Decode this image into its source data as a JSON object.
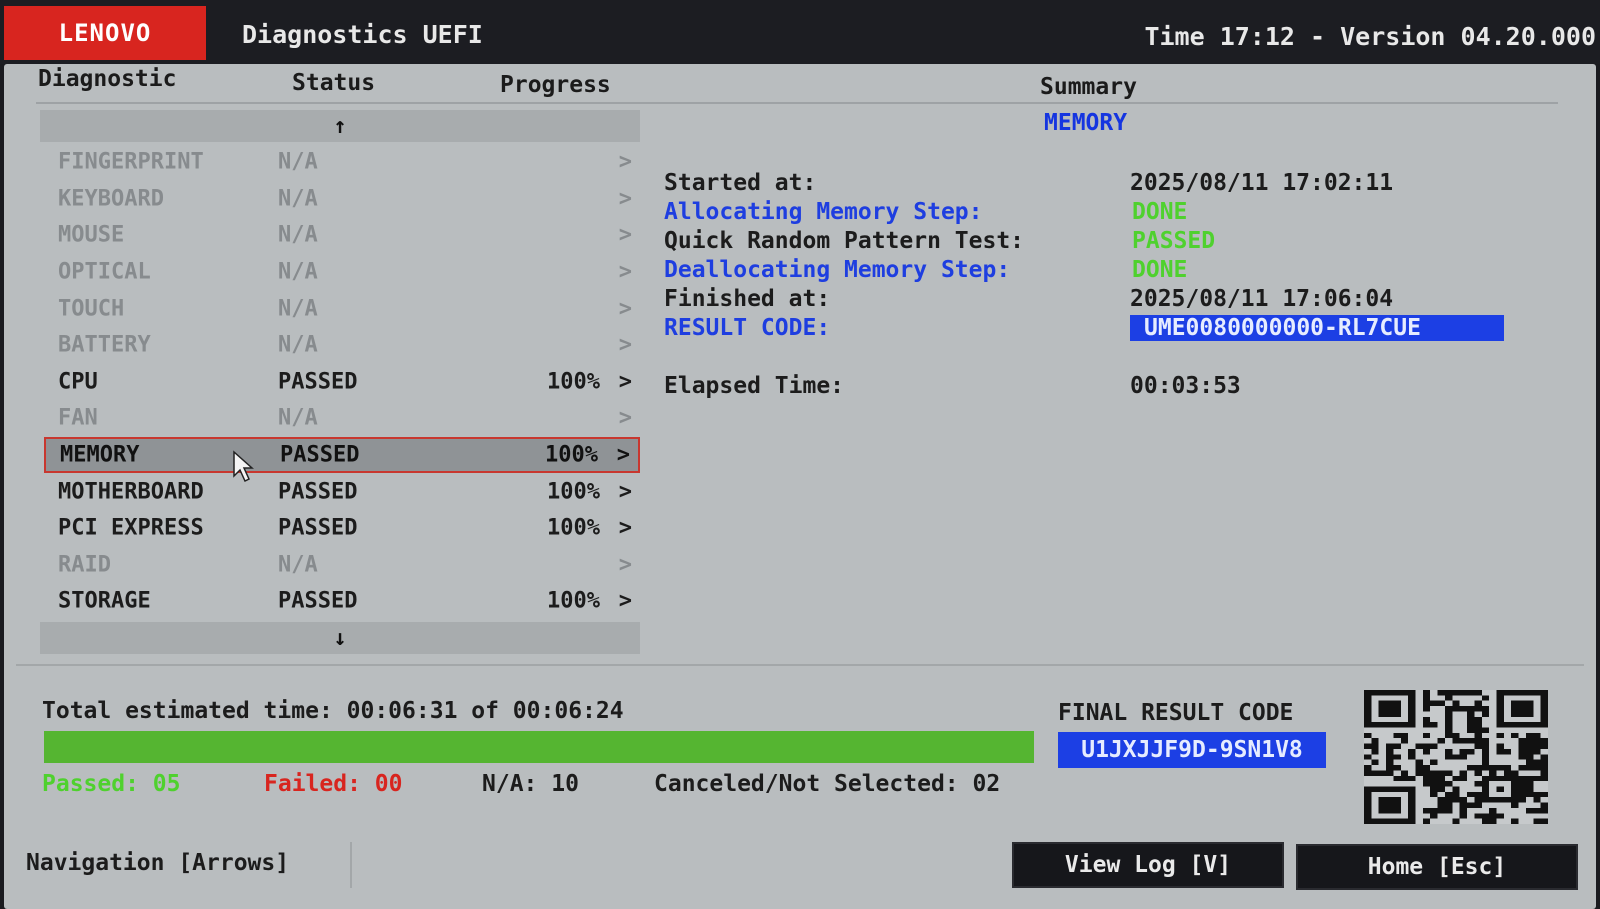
{
  "header": {
    "brand": "LENOVO",
    "app_title": "Diagnostics UEFI",
    "time_version": "Time 17:12 - Version 04.20.000"
  },
  "columns": {
    "diagnostic": "Diagnostic",
    "status": "Status",
    "progress": "Progress",
    "summary": "Summary"
  },
  "scroll": {
    "up": "↑",
    "down": "↓"
  },
  "diagnostics": [
    {
      "name": "FINGERPRINT",
      "status": "N/A",
      "progress": "",
      "chevron": ">"
    },
    {
      "name": "KEYBOARD",
      "status": "N/A",
      "progress": "",
      "chevron": ">"
    },
    {
      "name": "MOUSE",
      "status": "N/A",
      "progress": "",
      "chevron": ">"
    },
    {
      "name": "OPTICAL",
      "status": "N/A",
      "progress": "",
      "chevron": ">"
    },
    {
      "name": "TOUCH",
      "status": "N/A",
      "progress": "",
      "chevron": ">"
    },
    {
      "name": "BATTERY",
      "status": "N/A",
      "progress": "",
      "chevron": ">"
    },
    {
      "name": "CPU",
      "status": "PASSED",
      "progress": "100%",
      "chevron": ">"
    },
    {
      "name": "FAN",
      "status": "N/A",
      "progress": "",
      "chevron": ">"
    },
    {
      "name": "MEMORY",
      "status": "PASSED",
      "progress": "100%",
      "chevron": ">"
    },
    {
      "name": "MOTHERBOARD",
      "status": "PASSED",
      "progress": "100%",
      "chevron": ">"
    },
    {
      "name": "PCI EXPRESS",
      "status": "PASSED",
      "progress": "100%",
      "chevron": ">"
    },
    {
      "name": "RAID",
      "status": "N/A",
      "progress": "",
      "chevron": ">"
    },
    {
      "name": "STORAGE",
      "status": "PASSED",
      "progress": "100%",
      "chevron": ">"
    }
  ],
  "summary": {
    "title": "MEMORY",
    "started_label": "Started at:",
    "started_value": "2025/08/11 17:02:11",
    "alloc_label": "Allocating Memory Step:",
    "alloc_value": "DONE",
    "quick_label": "Quick Random Pattern Test:",
    "quick_value": "PASSED",
    "dealloc_label": "Deallocating Memory Step:",
    "dealloc_value": "DONE",
    "finished_label": "Finished at:",
    "finished_value": "2025/08/11 17:06:04",
    "result_label": "RESULT CODE:",
    "result_value": "UME0080000000-RL7CUE",
    "elapsed_label": "Elapsed Time:",
    "elapsed_value": "00:03:53"
  },
  "totals": {
    "estimated": "Total estimated time: 00:06:31 of 00:06:24",
    "progress_fraction": 1.0,
    "passed": "Passed: 05",
    "failed": "Failed: 00",
    "na": "N/A: 10",
    "canceled": "Canceled/Not Selected: 02"
  },
  "final": {
    "label": "FINAL RESULT CODE",
    "code": "U1JXJJF9D-9SN1V8"
  },
  "footer": {
    "navigation": "Navigation [Arrows]",
    "view_log": "View Log [V]",
    "home": "Home [Esc]"
  },
  "colors": {
    "brand_red": "#d8251f",
    "panel": "#b9bdbf",
    "accent_blue": "#1c3fe4",
    "pass_green": "#4fd12e",
    "progress_green": "#55b531"
  }
}
